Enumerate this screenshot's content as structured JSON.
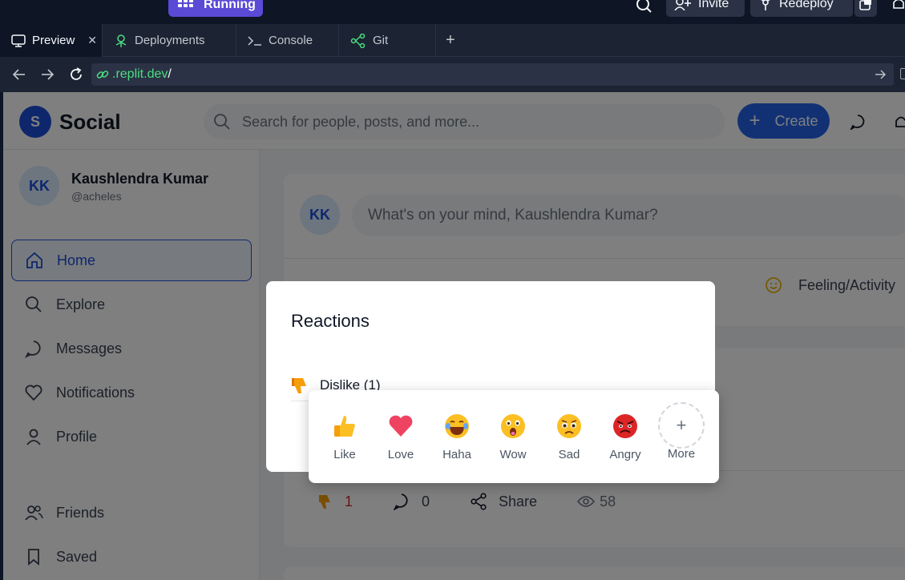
{
  "replit": {
    "run_label": "Running",
    "invite_label": "Invite",
    "redeploy_label": "Redeploy",
    "tabs": [
      {
        "label": "Preview"
      },
      {
        "label": "Deployments"
      },
      {
        "label": "Console"
      },
      {
        "label": "Git"
      }
    ],
    "new_tab": "+",
    "url_host": ".replit.dev",
    "url_path": "/"
  },
  "app": {
    "logo_letter": "S",
    "logo_text": "Social",
    "search_placeholder": "Search for people, posts, and more...",
    "create_label": "Create"
  },
  "profile": {
    "initials": "KK",
    "name": "Kaushlendra Kumar",
    "handle": "@acheles"
  },
  "nav": [
    {
      "label": "Home",
      "icon": "home-icon"
    },
    {
      "label": "Explore",
      "icon": "search-icon"
    },
    {
      "label": "Messages",
      "icon": "message-icon"
    },
    {
      "label": "Notifications",
      "icon": "heart-icon"
    },
    {
      "label": "Profile",
      "icon": "user-icon"
    },
    {
      "label": "Friends",
      "icon": "users-icon"
    },
    {
      "label": "Saved",
      "icon": "bookmark-icon"
    }
  ],
  "composer": {
    "initials": "KK",
    "placeholder": "What's on your mind, Kaushlendra Kumar?",
    "feeling_label": "Feeling/Activity"
  },
  "post": {
    "dislike_count": "1",
    "comment_count": "0",
    "share_label": "Share",
    "views": "58"
  },
  "modal": {
    "title": "Reactions",
    "row_label": "Dislike (1)"
  },
  "reactions": [
    {
      "label": "Like"
    },
    {
      "label": "Love"
    },
    {
      "label": "Haha"
    },
    {
      "label": "Wow"
    },
    {
      "label": "Sad"
    },
    {
      "label": "Angry"
    },
    {
      "label": "More"
    }
  ],
  "colors": {
    "replit_bg": "#0e1525",
    "replit_panel": "#1c2333",
    "run_purple": "#5a4ad6",
    "brand_blue": "#2563eb"
  }
}
